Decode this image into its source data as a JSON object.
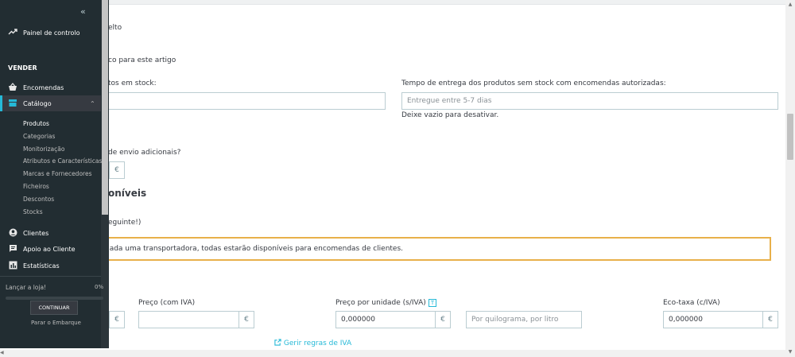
{
  "form": {
    "fragment_product": "elto",
    "fragment_for_item": "co para este artigo",
    "fragment_in_stock": "tos em stock:",
    "delivery_time_label": "Tempo de entrega dos produtos sem stock com encomendas autorizadas:",
    "delivery_time_placeholder": "Entregue entre 5-7 dias",
    "delivery_time_help": "Deixe vazio para desativar.",
    "fragment_shipping": "de envio adicionais?",
    "currency_symbol": "€",
    "fragment_available": "oníveis",
    "fragment_next": "eguinte!)",
    "alert_text": "nada uma transportadora, todas estarão disponíveis para encomendas de clientes.",
    "price_incl_label": "Preço (com IVA)",
    "unit_price_label": "Preço por unidade (s/IVA)",
    "unit_price_value": "0,000000",
    "unit_placeholder": "Por quilograma, por litro",
    "ecotax_label": "Eco-taxa (c/IVA)",
    "ecotax_value": "0,000000",
    "tax_rules_link": "Gerir regras de IVA",
    "help_badge": "T"
  },
  "sidebar": {
    "collapse_icon": "«",
    "dashboard": "Painel de controlo",
    "section_sell": "VENDER",
    "orders": "Encomendas",
    "catalog": "Catálogo",
    "catalog_items": [
      "Produtos",
      "Categorias",
      "Monitorização",
      "Atributos e Características",
      "Marcas e Fornecedores",
      "Ficheiros",
      "Descontos",
      "Stocks"
    ],
    "customers": "Clientes",
    "support": "Apoio ao Cliente",
    "stats": "Estatísticas",
    "launch_label": "Lançar a loja!",
    "launch_pct": "0%",
    "launch_progress": 0,
    "continue_btn": "CONTINUAR",
    "stop_link": "Parar o Embarque"
  },
  "colors": {
    "sidebar_bg": "#222d32",
    "accent": "#25b9d7",
    "alert_border": "#e8b04a"
  }
}
